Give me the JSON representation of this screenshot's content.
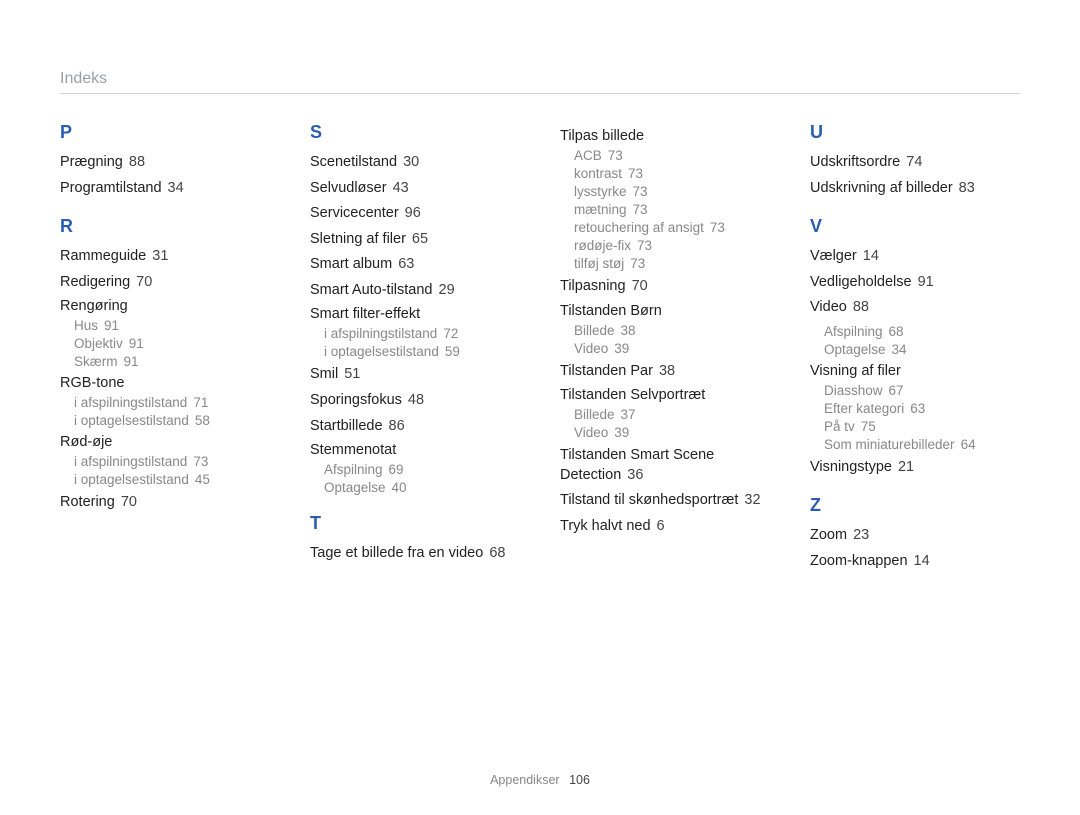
{
  "header": "Indeks",
  "footer": {
    "label": "Appendikser",
    "page": "106"
  },
  "cols": [
    [
      {
        "type": "letter",
        "text": "P"
      },
      {
        "type": "entry",
        "text": "Prægning",
        "page": "88"
      },
      {
        "type": "entry",
        "text": "Programtilstand",
        "page": "34"
      },
      {
        "type": "letter",
        "text": "R"
      },
      {
        "type": "entry",
        "text": "Rammeguide",
        "page": "31"
      },
      {
        "type": "entry",
        "text": "Redigering",
        "page": "70"
      },
      {
        "type": "subhead",
        "text": "Rengøring"
      },
      {
        "type": "sub",
        "text": "Hus",
        "page": "91"
      },
      {
        "type": "sub",
        "text": "Objektiv",
        "page": "91"
      },
      {
        "type": "sub",
        "text": "Skærm",
        "page": "91"
      },
      {
        "type": "subhead",
        "text": "RGB-tone"
      },
      {
        "type": "sub",
        "text": "i afspilningstilstand",
        "page": "71"
      },
      {
        "type": "sub",
        "text": "i optagelsestilstand",
        "page": "58"
      },
      {
        "type": "subhead",
        "text": "Rød-øje"
      },
      {
        "type": "sub",
        "text": "i afspilningstilstand",
        "page": "73"
      },
      {
        "type": "sub",
        "text": "i optagelsestilstand",
        "page": "45"
      },
      {
        "type": "entry",
        "text": "Rotering",
        "page": "70"
      }
    ],
    [
      {
        "type": "letter",
        "text": "S"
      },
      {
        "type": "entry",
        "text": "Scenetilstand",
        "page": "30"
      },
      {
        "type": "entry",
        "text": "Selvudløser",
        "page": "43"
      },
      {
        "type": "entry",
        "text": "Servicecenter",
        "page": "96"
      },
      {
        "type": "entry",
        "text": "Sletning af filer",
        "page": "65"
      },
      {
        "type": "entry",
        "text": "Smart album",
        "page": "63"
      },
      {
        "type": "entry",
        "text": "Smart Auto-tilstand",
        "page": "29"
      },
      {
        "type": "subhead",
        "text": "Smart filter-effekt"
      },
      {
        "type": "sub",
        "text": "i afspilningstilstand",
        "page": "72"
      },
      {
        "type": "sub",
        "text": "i optagelsestilstand",
        "page": "59"
      },
      {
        "type": "entry",
        "text": "Smil",
        "page": "51"
      },
      {
        "type": "entry",
        "text": "Sporingsfokus",
        "page": "48"
      },
      {
        "type": "entry",
        "text": "Startbillede",
        "page": "86"
      },
      {
        "type": "subhead",
        "text": "Stemmenotat"
      },
      {
        "type": "sub",
        "text": "Afspilning",
        "page": "69"
      },
      {
        "type": "sub",
        "text": "Optagelse",
        "page": "40"
      },
      {
        "type": "letter",
        "text": "T"
      },
      {
        "type": "entry",
        "text": "Tage et billede fra en video",
        "page": "68"
      }
    ],
    [
      {
        "type": "subhead",
        "text": "Tilpas billede"
      },
      {
        "type": "sub",
        "text": "ACB",
        "page": "73"
      },
      {
        "type": "sub",
        "text": "kontrast",
        "page": "73"
      },
      {
        "type": "sub",
        "text": "lysstyrke",
        "page": "73"
      },
      {
        "type": "sub",
        "text": "mætning",
        "page": "73"
      },
      {
        "type": "sub",
        "text": "retouchering af ansigt",
        "page": "73"
      },
      {
        "type": "sub",
        "text": "rødøje-fix",
        "page": "73"
      },
      {
        "type": "sub",
        "text": "tilføj støj",
        "page": "73"
      },
      {
        "type": "entry",
        "text": "Tilpasning",
        "page": "70"
      },
      {
        "type": "subhead",
        "text": "Tilstanden Børn"
      },
      {
        "type": "sub",
        "text": "Billede",
        "page": "38"
      },
      {
        "type": "sub",
        "text": "Video",
        "page": "39"
      },
      {
        "type": "entry",
        "text": "Tilstanden Par",
        "page": "38"
      },
      {
        "type": "subhead",
        "text": "Tilstanden Selvportræt"
      },
      {
        "type": "sub",
        "text": "Billede",
        "page": "37"
      },
      {
        "type": "sub",
        "text": "Video",
        "page": "39"
      },
      {
        "type": "entry",
        "text": "Tilstanden Smart Scene Detection",
        "page": "36"
      },
      {
        "type": "entry",
        "text": "Tilstand til skønhedsportræt",
        "page": "32"
      },
      {
        "type": "entry",
        "text": "Tryk halvt ned",
        "page": "6"
      }
    ],
    [
      {
        "type": "letter",
        "text": "U"
      },
      {
        "type": "entry",
        "text": "Udskriftsordre",
        "page": "74"
      },
      {
        "type": "entry",
        "text": "Udskrivning af billeder",
        "page": "83"
      },
      {
        "type": "letter",
        "text": "V"
      },
      {
        "type": "entry",
        "text": "Vælger",
        "page": "14"
      },
      {
        "type": "entry",
        "text": "Vedligeholdelse",
        "page": "91"
      },
      {
        "type": "entry",
        "text": "Video",
        "page": "88"
      },
      {
        "type": "sub",
        "text": "Afspilning",
        "page": "68"
      },
      {
        "type": "sub",
        "text": "Optagelse",
        "page": "34"
      },
      {
        "type": "subhead",
        "text": "Visning af filer"
      },
      {
        "type": "sub",
        "text": "Diasshow",
        "page": "67"
      },
      {
        "type": "sub",
        "text": "Efter kategori",
        "page": "63"
      },
      {
        "type": "sub",
        "text": "På tv",
        "page": "75"
      },
      {
        "type": "sub",
        "text": "Som miniaturebilleder",
        "page": "64"
      },
      {
        "type": "entry",
        "text": "Visningstype",
        "page": "21"
      },
      {
        "type": "letter",
        "text": "Z"
      },
      {
        "type": "entry",
        "text": "Zoom",
        "page": "23"
      },
      {
        "type": "entry",
        "text": "Zoom-knappen",
        "page": "14"
      }
    ]
  ]
}
